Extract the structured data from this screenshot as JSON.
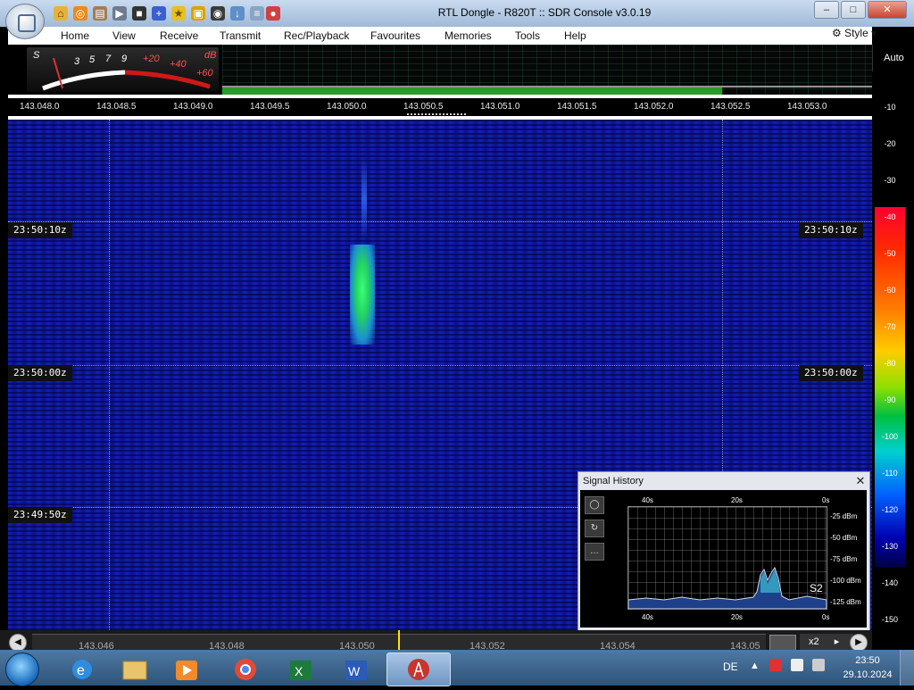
{
  "window": {
    "title": "RTL Dongle - R820T :: SDR Console v3.0.19",
    "minimize": "–",
    "maximize": "□",
    "close": "✕"
  },
  "menu": {
    "items": [
      "Home",
      "View",
      "Receive",
      "Transmit",
      "Rec/Playback",
      "Favourites",
      "Memories",
      "Tools",
      "Help"
    ],
    "style": "Style"
  },
  "smeter": {
    "s_label": "S",
    "db_label": "dB",
    "scale": [
      "3",
      "5",
      "7",
      "9",
      "+20",
      "+40",
      "+60"
    ]
  },
  "frequency_scale": [
    "143.048.0",
    "143.048.5",
    "143.049.0",
    "143.049.5",
    "143.050.0",
    "143.050.5",
    "143.051.0",
    "143.051.5",
    "143.052.0",
    "143.052.5",
    "143.053.0"
  ],
  "waterfall": {
    "timestamps": [
      "23:50:10z",
      "23:50:00z",
      "23:49:50z"
    ]
  },
  "db_scale": {
    "auto_label": "Auto",
    "labels": [
      "-10",
      "-20",
      "-30",
      "-40",
      "-50",
      "-60",
      "-70",
      "-80",
      "-90",
      "-100",
      "-110",
      "-120",
      "-130",
      "-140",
      "-150"
    ]
  },
  "signal_history": {
    "title": "Signal History",
    "close": "✕",
    "time_labels": [
      "40s",
      "20s",
      "0s"
    ],
    "dbm_labels": [
      "-25 dBm",
      "-50 dBm",
      "-75 dBm",
      "-100 dBm",
      "-125 dBm"
    ],
    "smeter_value": "S2",
    "buttons": [
      "◯",
      "↻",
      "…"
    ]
  },
  "bottom_bar": {
    "scale": [
      "143.046",
      "143.048",
      "143.050",
      "143.052",
      "143.054",
      "143.05"
    ],
    "zoom": "x2",
    "zoom_arrow": "▸",
    "left_button": "◀",
    "right_button": "▶"
  },
  "taskbar": {
    "language": "DE",
    "time": "23:50",
    "date": "29.10.2024"
  }
}
